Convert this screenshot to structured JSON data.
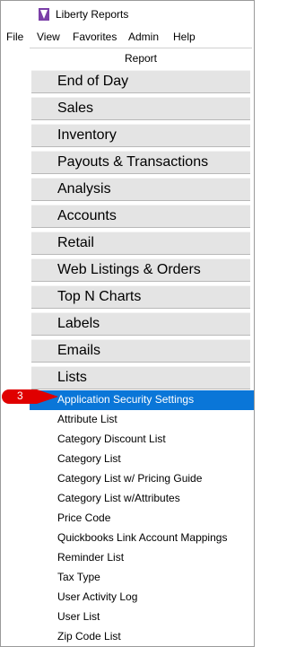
{
  "window": {
    "title": "Liberty Reports"
  },
  "menu": {
    "items": [
      "File",
      "View",
      "Favorites",
      "Admin",
      "Help"
    ]
  },
  "tabs": {
    "active": "Report"
  },
  "categories": [
    "End of Day",
    "Sales",
    "Inventory",
    "Payouts & Transactions",
    "Analysis",
    "Accounts",
    "Retail",
    "Web Listings & Orders",
    "Top N Charts",
    "Labels",
    "Emails",
    "Lists"
  ],
  "lists": {
    "selected_index": 0,
    "items": [
      "Application Security Settings",
      "Attribute List",
      "Category Discount List",
      "Category List",
      "Category List w/ Pricing Guide",
      "Category List w/Attributes",
      "Price Code",
      "Quickbooks Link Account Mappings",
      "Reminder List",
      "Tax Type",
      "User Activity Log",
      "User List",
      "Zip Code List"
    ]
  },
  "callout": {
    "text": "3"
  },
  "colors": {
    "selection": "#0a76d8",
    "callout": "#e00000"
  }
}
